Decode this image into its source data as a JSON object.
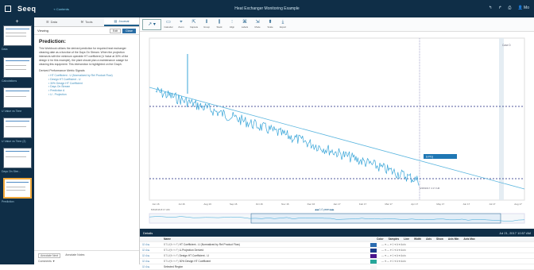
{
  "app": {
    "logo": "Seeq",
    "breadcrumb": "« Contents",
    "title": "Heat Exchanger Monitoring Example",
    "right_icons": [
      "↰",
      "↱",
      "⎙",
      "👤 Mo"
    ]
  },
  "slides": [
    {
      "label": "Data"
    },
    {
      "label": "Calculations"
    },
    {
      "label": "U Value vs Time"
    },
    {
      "label": "U Value vs Time (2)"
    },
    {
      "label": "Days On Stre..."
    },
    {
      "label": "Prediction"
    }
  ],
  "panel": {
    "tabs": [
      "Data",
      "Tools",
      "Journal"
    ],
    "viewing": "Viewing",
    "edit_label": "Edit",
    "close_label": "Close",
    "heading": "Prediction:",
    "body": "This Workbook utilizes the derived prediction for required heat exchanger cleaning date as a function of the Days On Stream. When the projection intersects with the minimum operable HT coefficient (U Value at 30% of the design U for this example), the plant should plan a maintenance outage for cleaning this equipment. This intersection is highlighted on the Graph.",
    "subheading": "Derived Performance Metric Signals",
    "signals": [
      "HT Coefficient - U (Normalized by Rel Product Flow)",
      "Design HT Coefficient - U",
      "30% Design HT Coefficient",
      "Days On Stream",
      "Prediction A",
      "U - Projection"
    ],
    "foot_text": "Annotate Next",
    "foot_box": "Annotate Notes",
    "foot_link": "Comments ▼"
  },
  "toolbar": {
    "view": "↗ ▾",
    "items": [
      {
        "glyph": "▭",
        "label": "Calendar"
      },
      {
        "glyph": "⌖",
        "label": "Zoom"
      },
      {
        "glyph": "⇱",
        "label": "Capsule"
      },
      {
        "glyph": "⫴",
        "label": "Group"
      },
      {
        "glyph": "⫼",
        "label": "Stack"
      },
      {
        "glyph": "⫶",
        "label": "Align"
      },
      {
        "glyph": "⌘",
        "label": "Labels"
      },
      {
        "glyph": "⇲",
        "label": "Mode"
      },
      {
        "glyph": "⬍",
        "label": "Scale"
      },
      {
        "glyph": "⤓",
        "label": "Export"
      }
    ]
  },
  "chart_data": {
    "type": "line",
    "series": [
      {
        "name": "HT Coefficient - U (Normalized by Rel Product Flow)",
        "color": "#38a5d8"
      },
      {
        "name": "U - Projection",
        "color": "#5cb6df"
      },
      {
        "name": "Design HT Coefficient - U",
        "color": "#1a237e"
      },
      {
        "name": "30% Design HT Coefficient",
        "color": "#1a237e"
      }
    ],
    "x_ticks": [
      "Jun 16",
      "Jul 16",
      "Aug 16",
      "Sep 16",
      "Oct 16",
      "Nov 16",
      "Dec 16",
      "Jan 17",
      "Feb 17",
      "Mar 17",
      "Apr 17",
      "May 17",
      "Jun 17",
      "Jul 17",
      "Aug 17"
    ],
    "start_label": "5/3/2016 8:17 AM",
    "capsule_value": "6/28/2017 4:17 AM",
    "callout_label": "Intersect",
    "capsule_label": "U-Proj",
    "duration": "◀◀  1.0 years  ▶▶",
    "y_right_label": "Case D"
  },
  "details": {
    "header": "Details",
    "range": "Jul 21, 2017 10:57 AM",
    "columns": [
      "",
      "Name",
      "Color",
      "Samples",
      "Line",
      "Width",
      "Line",
      "Axis",
      "Align",
      "Show",
      "Auto",
      "Axis Min",
      "Axis Max"
    ],
    "rows": [
      {
        "id": "BTU/(ft²·h·F)",
        "name": "HT Coefficient - U (Normalized by Rel Product Flow)",
        "color": "#2b6cb0",
        "rest": "— ▾  —  ▾  1  ▾  A  ▾  Auto"
      },
      {
        "id": "BTU/(ft²·h·F)",
        "name": "U-Projection Derived",
        "color": "#1a3c8a",
        "rest": "— ▾  —  ▾  1  ▾  A  ▾  Auto"
      },
      {
        "id": "BTU/(ft²·h·F)",
        "name": "Design HT Coefficient - U",
        "color": "#4a148c",
        "rest": "— ▾  —  ▾  1  ▾  A  ▾  Auto"
      },
      {
        "id": "BTU/(ft²·h·F)",
        "name": "30% Design HT Coefficient",
        "color": "#26a69a",
        "rest": "— ▾  —  ▾  1  ▾  A  ▾  Auto"
      },
      {
        "id": "",
        "name": "Selected Region",
        "color": "#f5f5f5",
        "rest": ""
      }
    ]
  }
}
